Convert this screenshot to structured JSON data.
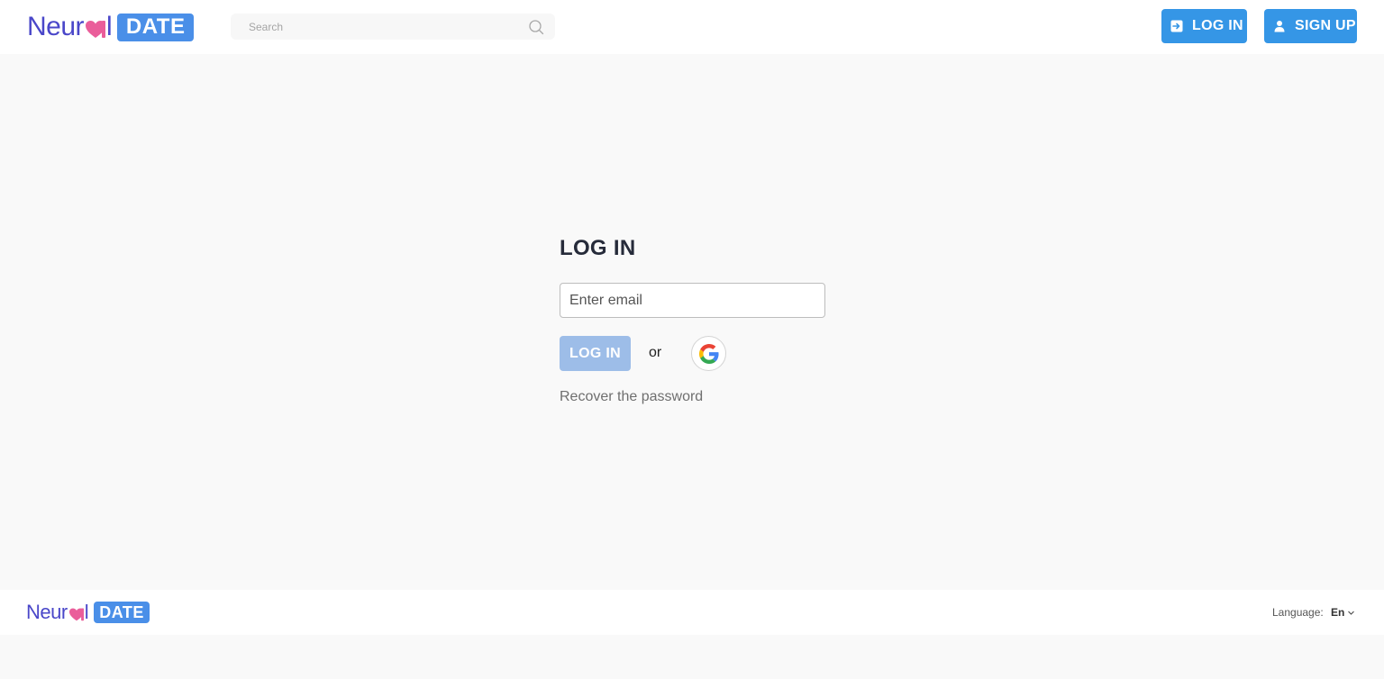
{
  "brand": {
    "word_part1": "Neur",
    "word_part2": "l",
    "date_badge": "DATE",
    "colors": {
      "word": "#4a47c9",
      "heart": "#ea5d9a",
      "badge": "#4a8fe8"
    }
  },
  "header": {
    "search": {
      "placeholder": "Search",
      "value": "",
      "icon": "search-icon"
    },
    "login_button": {
      "label": "LOG IN",
      "icon": "login-icon"
    },
    "signup_button": {
      "label": "SIGN UP",
      "icon": "user-icon"
    }
  },
  "login": {
    "title": "LOG IN",
    "email": {
      "placeholder": "Enter email",
      "value": ""
    },
    "submit_label": "LOG IN",
    "or_text": "or",
    "google_icon": "google-icon",
    "recover_label": "Recover the password"
  },
  "footer": {
    "language_label": "Language:",
    "language_value": "En",
    "language_icon": "chevron-down-icon"
  },
  "colors": {
    "accent": "#3596e6",
    "disabled_button": "#9dbde8",
    "background": "#f9f9f9"
  }
}
